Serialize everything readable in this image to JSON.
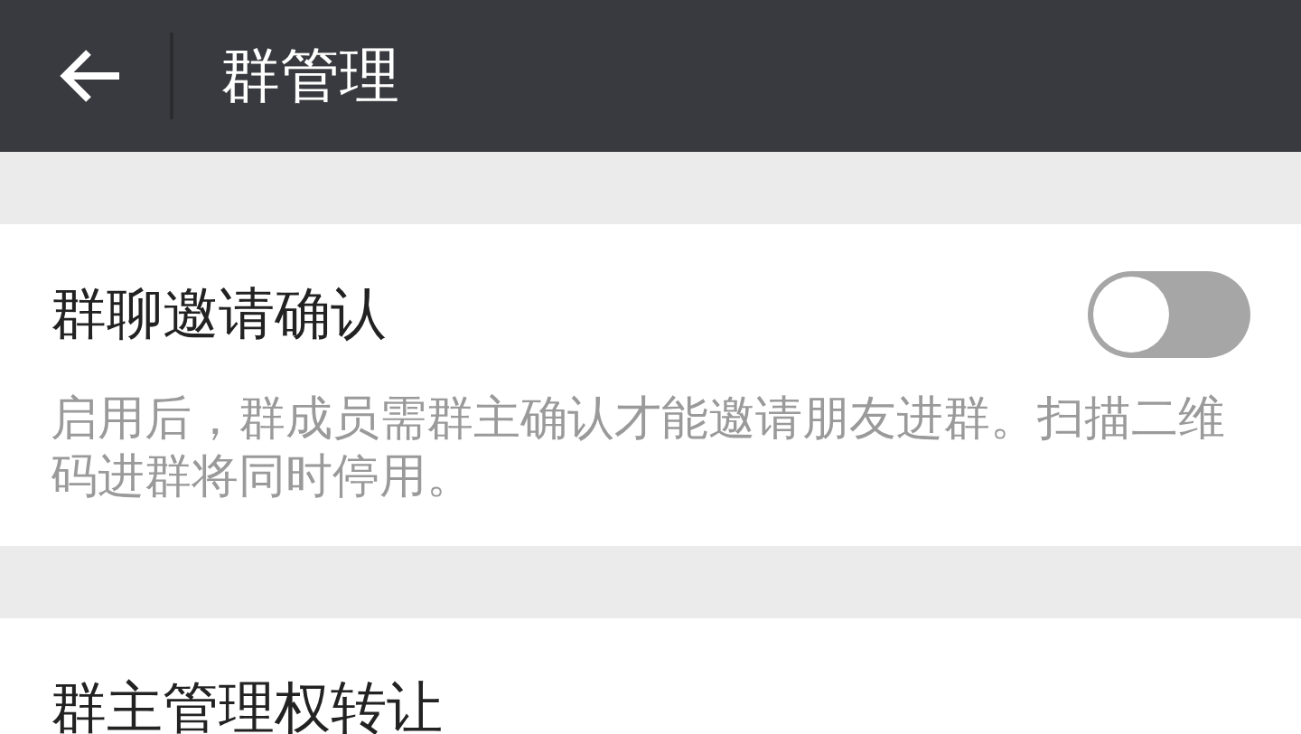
{
  "header": {
    "title": "群管理"
  },
  "settings": [
    {
      "label": "群聊邀请确认",
      "on": false,
      "description": "启用后，群成员需群主确认才能邀请朋友进群。扫描二维码进群将同时停用。"
    },
    {
      "label": "群主管理权转让"
    }
  ]
}
